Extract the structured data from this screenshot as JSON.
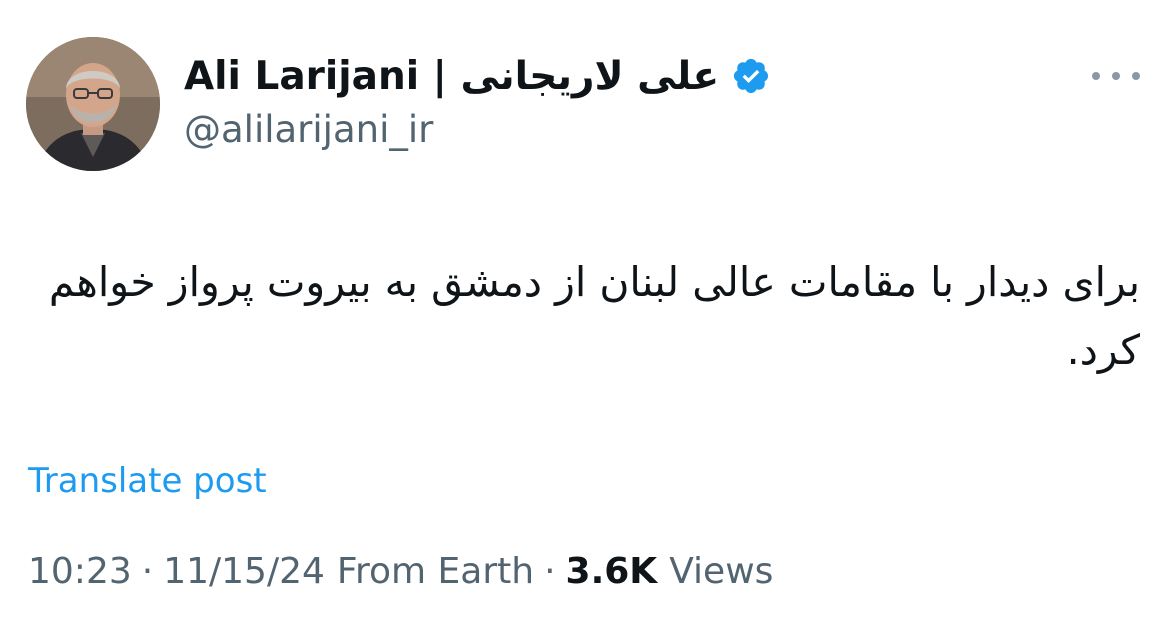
{
  "author": {
    "display_name": "Ali Larijani | علی لاریجانی",
    "handle": "@alilarijani_ir",
    "verified_badge": "verified-badge-icon",
    "avatar": "author-avatar"
  },
  "post": {
    "text": "برای دیدار با مقامات عالی لبنان از دمشق به بیروت پرواز خواهم کرد."
  },
  "actions": {
    "more_icon": "more-options-icon",
    "translate_label": "Translate post"
  },
  "meta": {
    "time": "10:23",
    "date": "11/15/24",
    "source": "From Earth",
    "separator": "·",
    "views_count": "3.6K",
    "views_label": "Views"
  },
  "colors": {
    "accent": "#1d9bf0",
    "text_primary": "#0f1419",
    "text_secondary": "#536471"
  }
}
